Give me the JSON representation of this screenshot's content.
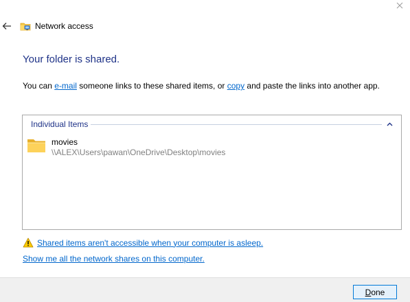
{
  "window": {
    "title": "Network access",
    "close_glyph": "✕",
    "back_glyph": "←"
  },
  "heading": "Your folder is shared.",
  "description": {
    "part1": "You can ",
    "email_link": "e-mail",
    "part2": " someone links to these shared items, or ",
    "copy_link": "copy",
    "part3": " and paste the links into another app."
  },
  "shared_items": {
    "group_label": "Individual Items",
    "items": [
      {
        "name": "movies",
        "path": "\\\\ALEX\\Users\\pawan\\OneDrive\\Desktop\\movies"
      }
    ]
  },
  "warning_link": "Shared items aren't accessible when your computer is asleep.",
  "shares_link": "Show me all the network shares on this computer.",
  "footer": {
    "done_label_first": "D",
    "done_label_rest": "one"
  },
  "colors": {
    "heading": "#1e3287",
    "link": "#0066cc",
    "button_border": "#0078d7",
    "footer_bg": "#f0f0f0"
  },
  "icons": [
    "close-icon",
    "back-arrow-icon",
    "network-folder-icon",
    "chevron-up-icon",
    "folder-icon",
    "warning-icon"
  ]
}
